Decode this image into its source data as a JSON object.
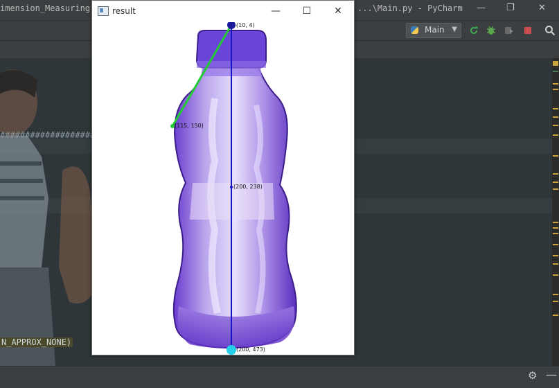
{
  "ide": {
    "title_left": "imension_Measuring",
    "title_right": "...\\Main.py - PyCharm",
    "run_config": "Main",
    "code_hash_line": "###################",
    "code_contour_line": "N_APPROX_NONE)",
    "colors": {
      "editor_bg": "#2f3639",
      "toolbar_bg": "#3c3f41",
      "marker": "#c9a33b"
    }
  },
  "cv_window": {
    "title": "result",
    "minimize": "—",
    "maximize": "☐",
    "close": "✕",
    "points": {
      "top": "(10, 4)",
      "side": "(115, 150)",
      "center": "(200, 238)",
      "bottom": "(200, 473)"
    },
    "colors": {
      "axis_line": "#1515c8",
      "edge_line": "#22cc33",
      "bottle": "#7a4fd1",
      "cap": "#6a45d8",
      "marker_top": "#1a1a9a",
      "marker_bottom": "#24d0e8"
    }
  }
}
